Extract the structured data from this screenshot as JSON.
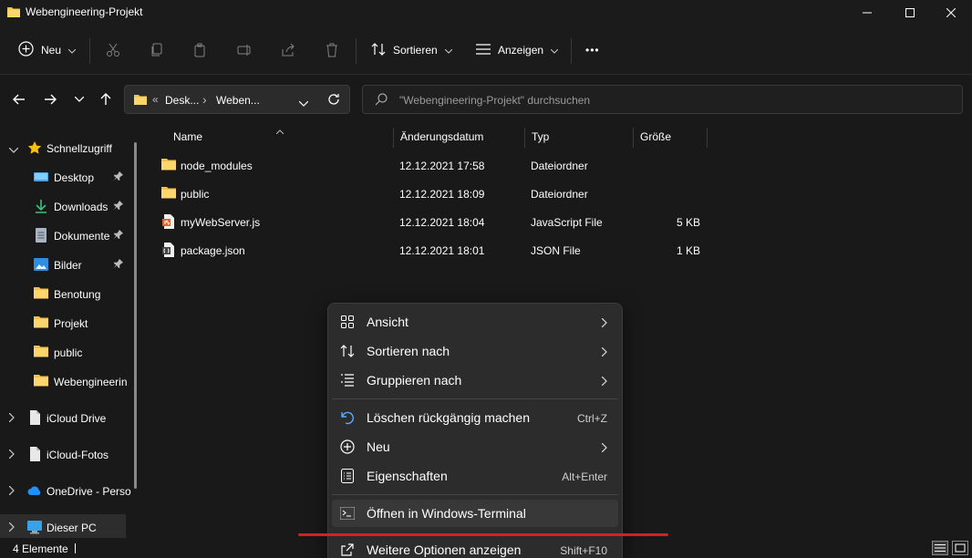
{
  "window": {
    "title": "Webengineering-Projekt"
  },
  "toolbar": {
    "new_label": "Neu",
    "sort_label": "Sortieren",
    "view_label": "Anzeigen",
    "more_label": "•••"
  },
  "address": {
    "crumb_prefix": "«",
    "crumb_1": "Desk...",
    "crumb_sep": "›",
    "crumb_2": "Weben..."
  },
  "search": {
    "placeholder": "\"Webengineering-Projekt\" durchsuchen"
  },
  "sidebar": {
    "quick_access": "Schnellzugriff",
    "items": [
      {
        "label": "Desktop",
        "icon": "desktop-icon",
        "pinned": true
      },
      {
        "label": "Downloads",
        "icon": "download-icon",
        "pinned": true
      },
      {
        "label": "Dokumente",
        "icon": "document-icon",
        "pinned": true
      },
      {
        "label": "Bilder",
        "icon": "pictures-icon",
        "pinned": true
      },
      {
        "label": "Benotung",
        "icon": "folder-icon",
        "pinned": false
      },
      {
        "label": "Projekt",
        "icon": "folder-icon",
        "pinned": false
      },
      {
        "label": "public",
        "icon": "folder-icon",
        "pinned": false
      },
      {
        "label": "Webengineerin",
        "icon": "folder-icon",
        "pinned": false
      }
    ],
    "icloud_drive": "iCloud Drive",
    "icloud_photos": "iCloud-Fotos",
    "onedrive": "OneDrive - Perso",
    "this_pc": "Dieser PC"
  },
  "columns": {
    "name": "Name",
    "date": "Änderungsdatum",
    "type": "Typ",
    "size": "Größe"
  },
  "files": [
    {
      "name": "node_modules",
      "date": "12.12.2021 17:58",
      "type": "Dateiordner",
      "size": ""
    },
    {
      "name": "public",
      "date": "12.12.2021 18:09",
      "type": "Dateiordner",
      "size": ""
    },
    {
      "name": "myWebServer.js",
      "date": "12.12.2021 18:04",
      "type": "JavaScript File",
      "size": "5 KB"
    },
    {
      "name": "package.json",
      "date": "12.12.2021 18:01",
      "type": "JSON File",
      "size": "1 KB"
    }
  ],
  "context_menu": {
    "view": "Ansicht",
    "sort_by": "Sortieren nach",
    "group_by": "Gruppieren nach",
    "undo_delete": "Löschen rückgängig machen",
    "undo_shortcut": "Ctrl+Z",
    "new": "Neu",
    "properties": "Eigenschaften",
    "properties_shortcut": "Alt+Enter",
    "open_terminal": "Öffnen in Windows-Terminal",
    "more_options": "Weitere Optionen anzeigen",
    "more_options_shortcut": "Shift+F10"
  },
  "status": {
    "count": "4 Elemente"
  },
  "colors": {
    "accent": "#0a84ff",
    "folder": "#f3c14b",
    "highlight_underline": "#d32020"
  }
}
